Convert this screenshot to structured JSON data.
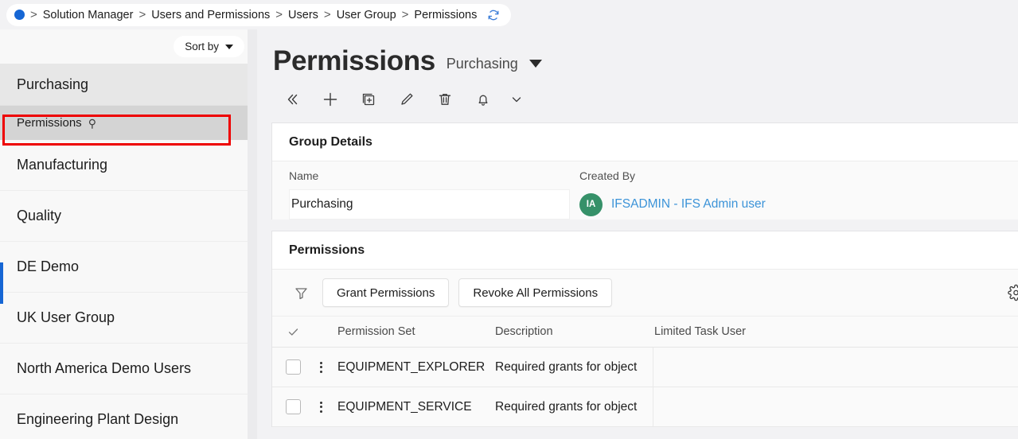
{
  "breadcrumb": {
    "status_dot": "blue-dot-icon",
    "items": [
      "Solution Manager",
      "Users and Permissions",
      "Users",
      "User Group",
      "Permissions"
    ],
    "separator": ">",
    "refresh_icon": "refresh-icon"
  },
  "sidebar": {
    "sort_by_label": "Sort by",
    "group_label": "Purchasing",
    "pinned_item": {
      "label": "Permissions",
      "pin_icon": "pin-icon"
    },
    "items": [
      {
        "label": "Manufacturing"
      },
      {
        "label": "Quality"
      },
      {
        "label": "DE Demo"
      },
      {
        "label": "UK User Group"
      },
      {
        "label": "North America Demo Users"
      },
      {
        "label": "Engineering Plant Design"
      }
    ]
  },
  "page": {
    "title": "Permissions",
    "context": "Purchasing",
    "context_caret": "caret-down-icon"
  },
  "toolbar": {
    "buttons": [
      {
        "name": "collapse-icon",
        "glyph": "«"
      },
      {
        "name": "add-icon",
        "glyph": "+"
      },
      {
        "name": "duplicate-icon",
        "glyph": "duplicate"
      },
      {
        "name": "edit-icon",
        "glyph": "pencil"
      },
      {
        "name": "delete-icon",
        "glyph": "trash"
      },
      {
        "name": "notification-icon",
        "glyph": "bell"
      },
      {
        "name": "more-chevron-icon",
        "glyph": "chevron-down"
      }
    ]
  },
  "group_details": {
    "title": "Group Details",
    "name_label": "Name",
    "name_value": "Purchasing",
    "created_by_label": "Created By",
    "created_by_initials": "IA",
    "created_by_value": "IFSADMIN - IFS Admin user",
    "avatar_color": "#369169",
    "link_color": "#3b93d8"
  },
  "permissions": {
    "title": "Permissions",
    "filter_icon": "filter-funnel-icon",
    "grant_label": "Grant Permissions",
    "revoke_label": "Revoke All Permissions",
    "settings_icon": "gear-icon",
    "settings_caret": "chevron-down-icon",
    "columns": [
      "Permission Set",
      "Description",
      "Limited Task User"
    ],
    "select_all_icon": "checkmark-icon",
    "rows": [
      {
        "permission_set": "EQUIPMENT_EXPLORER",
        "description": "Required grants for object",
        "limited_task_user": ""
      },
      {
        "permission_set": "EQUIPMENT_SERVICE",
        "description": "Required grants for object",
        "limited_task_user": ""
      }
    ]
  },
  "annotation": {
    "color": "#ee0000"
  }
}
